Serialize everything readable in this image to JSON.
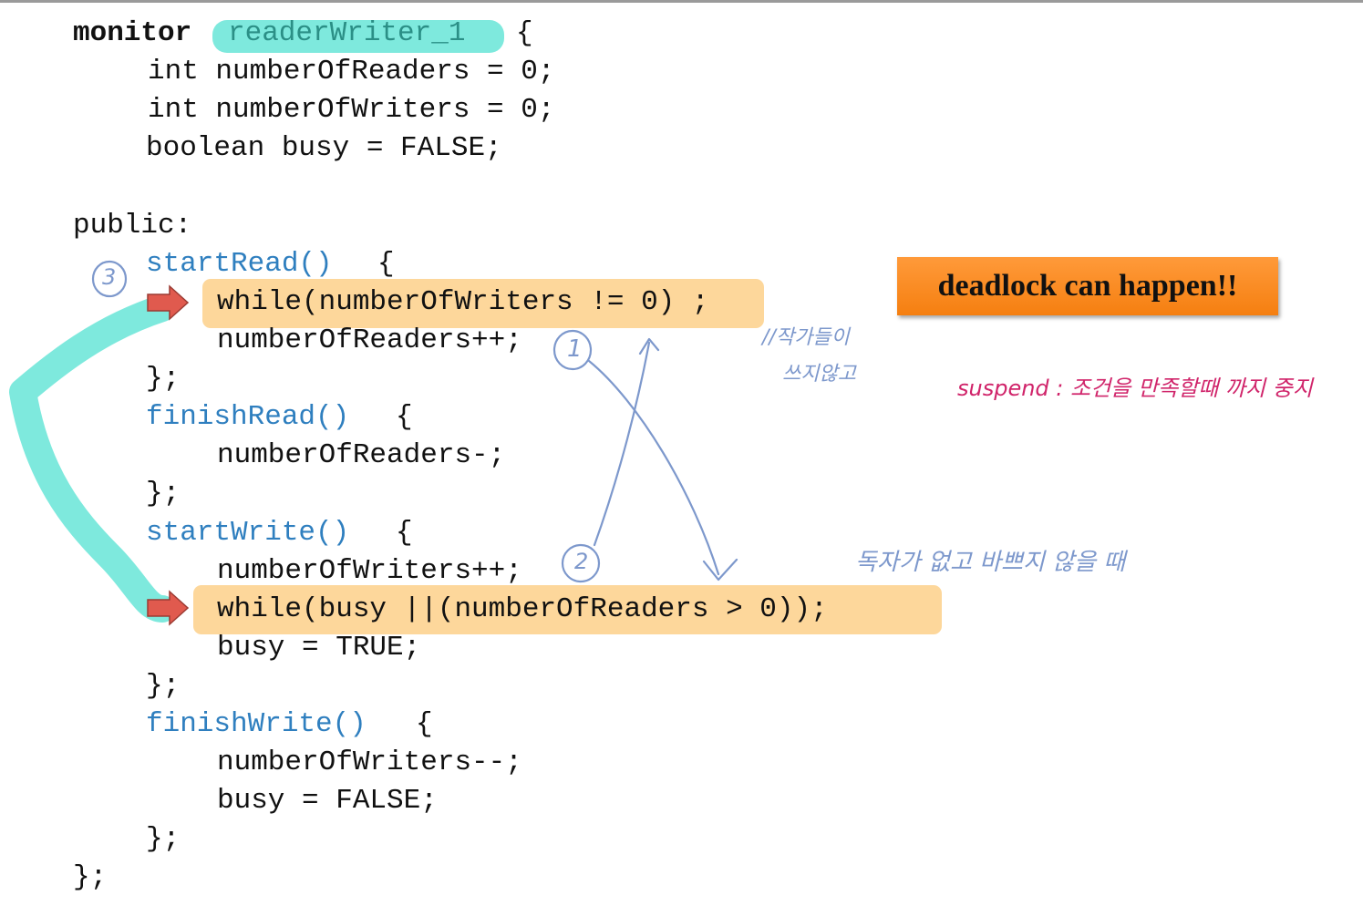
{
  "code": {
    "line1_keyword": "monitor",
    "line1_name": "readerWriter_1",
    "line1_brace": "{",
    "line2": "int numberOfReaders = 0;",
    "line3": "int numberOfWriters = 0;",
    "line4": "boolean busy = FALSE;",
    "line6": "public:",
    "line7_fn": "startRead()",
    "line7_brace": "{",
    "line8": "while(numberOfWriters != 0) ;",
    "line9": "numberOfReaders++;",
    "line10": "};",
    "line11_fn": "finishRead()",
    "line11_brace": "{",
    "line12": "numberOfReaders-;",
    "line13": "};",
    "line14_fn": "startWrite()",
    "line14_brace": "{",
    "line15": "numberOfWriters++;",
    "line16": "while(busy ||(numberOfReaders > 0));",
    "line17": "busy = TRUE;",
    "line18": "};",
    "line19_fn": "finishWrite()",
    "line19_brace": "{",
    "line20": "numberOfWriters--;",
    "line21": "busy = FALSE;",
    "line22": "};",
    "line23": "};"
  },
  "callout": {
    "text": "deadlock can happen!!"
  },
  "notes": {
    "circle_1": "1",
    "circle_2": "2",
    "circle_3": "3",
    "writers_note_line1": "//작가들이",
    "writers_note_line2": "쓰지않고",
    "suspend_note": "suspend : 조건을 만족할때 까지 중지",
    "reader_note": "독자가 없고 바쁘지 않을 때"
  },
  "colors": {
    "teal_highlight": "#7ee9dd",
    "orange_highlight": "#fdd79b",
    "callout_orange": "#f57f10",
    "function_blue": "#2f7fbf",
    "handwriting_blue": "#7d98cc",
    "handwriting_pink": "#d0246a",
    "arrow_red": "#e05a4e"
  },
  "icons": {
    "arrow": "red-right-arrow-icon"
  }
}
